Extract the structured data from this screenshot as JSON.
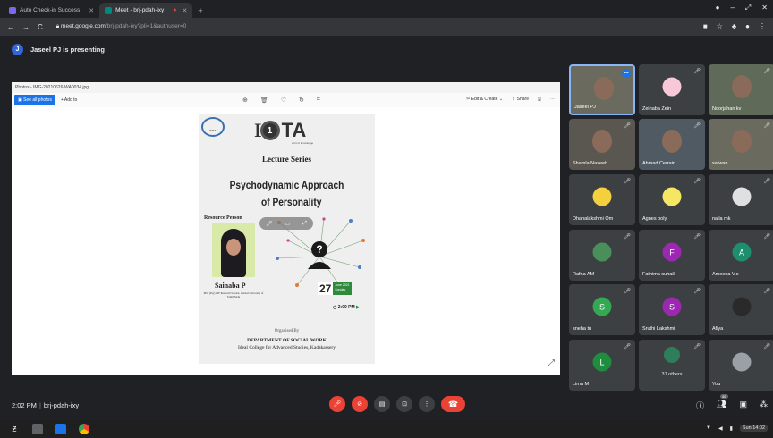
{
  "browser": {
    "tabs": [
      {
        "title": "Auto Check-in Success",
        "icon_color": "#7b68ee",
        "active": false
      },
      {
        "title": "Meet - brj-pdah-ixy",
        "icon_color": "#00897b",
        "active": true
      }
    ],
    "url_host": "meet.google.com",
    "url_path": "/brj-pdah-ixy?pli=1&authuser=0"
  },
  "presenting": {
    "avatar_letter": "J",
    "text": "Jaseel PJ is presenting"
  },
  "photos_app": {
    "window_title": "Photos - IMG-20210626-WA0034.jpg",
    "see_all_label": "See all photos",
    "add_to_label": "Add to",
    "edit_create_label": "Edit & Create",
    "share_label": "Share"
  },
  "poster": {
    "logo_left_text": "IMSA",
    "logo_main_left": "I",
    "logo_main_ring": "1",
    "logo_main_right": "TA",
    "tagline": "a bit of knowledge",
    "series": "Lecture Series",
    "topic_line1": "Psychodynamic Approach",
    "topic_line2": "of Personality",
    "resource_label": "Resource Person",
    "speaker_name": "Sainaba P",
    "speaker_details": "MSc (Psy) JRF Research Scholar, Central University of Tamil Nadu",
    "date_day": "27",
    "date_month": "June 2021",
    "date_weekday": "Sunday",
    "time": "2:00 PM",
    "organised_by": "Organised By",
    "department": "DEPARTMENT OF SOCIAL WORK",
    "college": "Ideal College for Advanced Studies, Kadakassery"
  },
  "participants": [
    {
      "name": "Jaseel PJ",
      "type": "video",
      "self": true
    },
    {
      "name": "Zeinaba Zein",
      "type": "avatar",
      "color": "#f8c8d8",
      "letter": ""
    },
    {
      "name": "Noorjahan kv",
      "type": "video"
    },
    {
      "name": "Shamla Naseeb",
      "type": "video"
    },
    {
      "name": "Ahmad Cerrain",
      "type": "video"
    },
    {
      "name": "safwan",
      "type": "video"
    },
    {
      "name": "Dhanalakshmi Om",
      "type": "avatar",
      "color": "#f4d03f",
      "letter": ""
    },
    {
      "name": "Agnes poly",
      "type": "avatar",
      "color": "#f5e663",
      "letter": ""
    },
    {
      "name": "najla mk",
      "type": "avatar",
      "color": "#e0e0e0",
      "letter": ""
    },
    {
      "name": "Rafna AM",
      "type": "avatar",
      "color": "#4a8f5a",
      "letter": ""
    },
    {
      "name": "Fathima suhail",
      "type": "avatar",
      "color": "#9c27b0",
      "letter": "F"
    },
    {
      "name": "Ameena V.s",
      "type": "avatar",
      "color": "#1e8e6e",
      "letter": "A"
    },
    {
      "name": "sneha tu",
      "type": "avatar",
      "color": "#34a853",
      "letter": "S"
    },
    {
      "name": "Sruthi Lakshmi",
      "type": "avatar",
      "color": "#9c27b0",
      "letter": "S"
    },
    {
      "name": "Afiya",
      "type": "avatar",
      "color": "#2a2a2a",
      "letter": ""
    },
    {
      "name": "Lima M",
      "type": "avatar",
      "color": "#1e8e3e",
      "letter": "L"
    },
    {
      "name": "",
      "type": "others",
      "others_label": "31 others"
    },
    {
      "name": "You",
      "type": "avatar",
      "color": "#9aa0a6",
      "letter": ""
    }
  ],
  "meeting": {
    "time": "2:02 PM",
    "code": "brj-pdah-ixy",
    "people_count": "49"
  },
  "taskbar": {
    "clock": "Sun 14:02"
  }
}
